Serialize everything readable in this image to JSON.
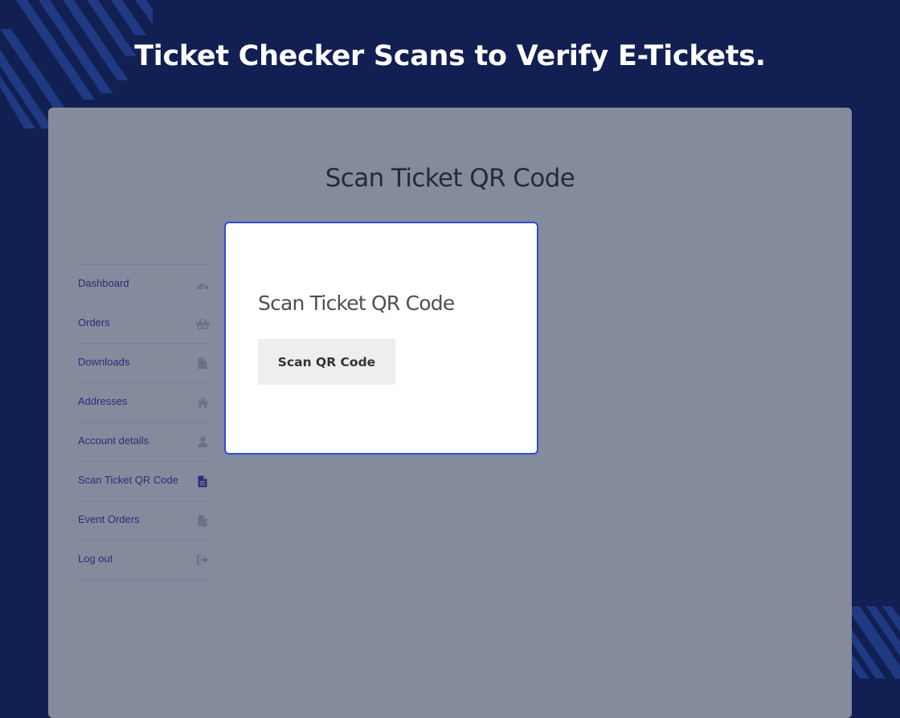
{
  "headline": "Ticket Checker Scans to Verify E-Tickets.",
  "page": {
    "title": "Scan Ticket QR Code"
  },
  "nav": {
    "items": [
      {
        "label": "Dashboard",
        "icon": "dashboard-icon"
      },
      {
        "label": "Orders",
        "icon": "basket-icon"
      },
      {
        "label": "Downloads",
        "icon": "file-icon"
      },
      {
        "label": "Addresses",
        "icon": "home-icon"
      },
      {
        "label": "Account details",
        "icon": "user-icon"
      },
      {
        "label": "Scan Ticket QR Code",
        "icon": "file-text-icon",
        "active": true
      },
      {
        "label": "Event Orders",
        "icon": "file-icon"
      },
      {
        "label": "Log out",
        "icon": "sign-out-icon"
      }
    ]
  },
  "modal": {
    "title": "Scan Ticket QR Code",
    "button_label": "Scan QR Code"
  },
  "colors": {
    "background": "#111f52",
    "panel_overlay": "#848b9d",
    "modal_border": "#2e49e0",
    "nav_text": "#2a2d78",
    "decor_stripes": "#1f3a82"
  }
}
